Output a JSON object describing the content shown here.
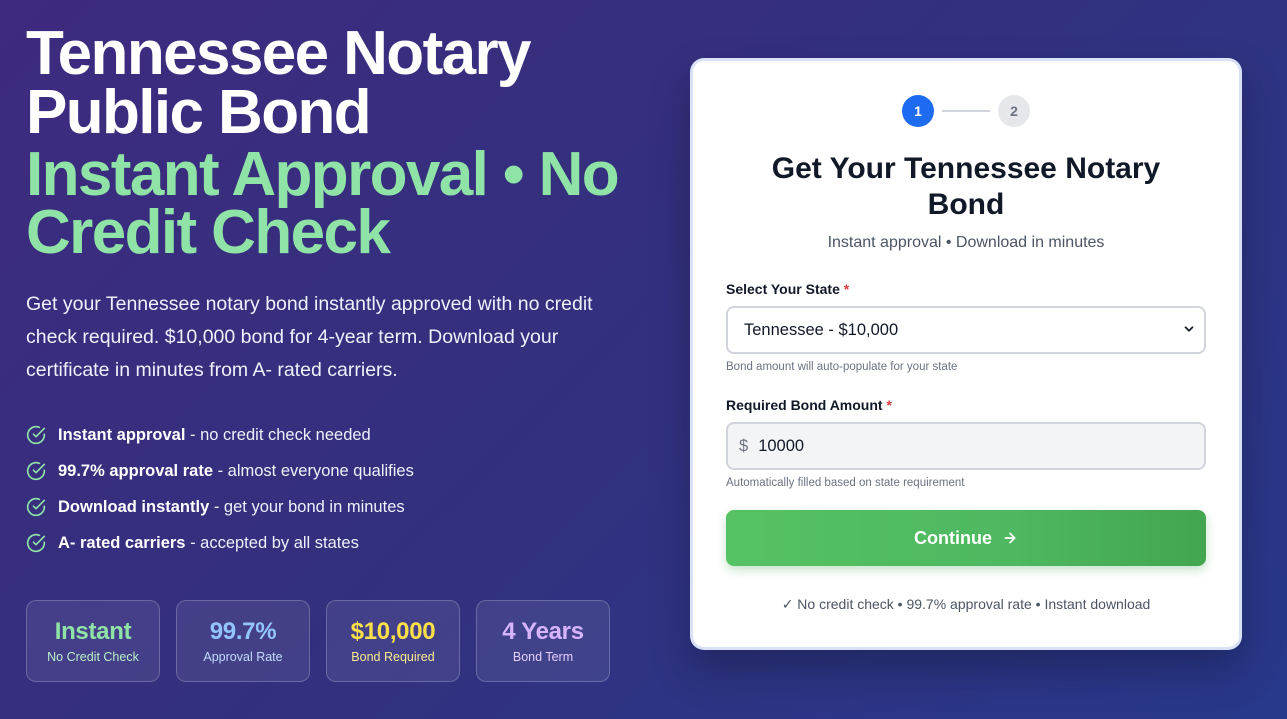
{
  "hero": {
    "title": "Tennessee Notary Public Bond",
    "highlight": "Instant Approval • No Credit Check",
    "description": "Get your Tennessee notary bond instantly approved with no credit check required. $10,000 bond for 4-year term. Download your certificate in minutes from A- rated carriers.",
    "features": [
      {
        "bold": "Instant approval",
        "text": " - no credit check needed"
      },
      {
        "bold": "99.7% approval rate",
        "text": " - almost everyone qualifies"
      },
      {
        "bold": "Download instantly",
        "text": " - get your bond in minutes"
      },
      {
        "bold": "A- rated carriers",
        "text": " - accepted by all states"
      }
    ],
    "check_icon": "check-circle-icon"
  },
  "stats": [
    {
      "value": "Instant",
      "label": "No Credit Check",
      "color": "#8fe3a6"
    },
    {
      "value": "99.7%",
      "label": "Approval Rate",
      "color": "#93c5fd"
    },
    {
      "value": "$10,000",
      "label": "Bond Required",
      "color": "#fde047"
    },
    {
      "value": "4 Years",
      "label": "Bond Term",
      "color": "#d8b4fe"
    }
  ],
  "form": {
    "steps": [
      "1",
      "2"
    ],
    "title": "Get Your Tennessee Notary Bond",
    "subtitle": "Instant approval • Download in minutes",
    "state_label": "Select Your State",
    "required_mark": "*",
    "state_value": "Tennessee - $10,000",
    "state_hint": "Bond amount will auto-populate for your state",
    "amount_label": "Required Bond Amount",
    "currency_symbol": "$",
    "amount_value": "10000",
    "amount_hint": "Automatically filled based on state requirement",
    "continue_label": "Continue",
    "trust_text": "✓ No credit check • 99.7% approval rate • Instant download"
  },
  "colors": {
    "accent_blue": "#1d6bf0",
    "accent_green": "#4db860",
    "highlight_green": "#8fe3a6"
  }
}
